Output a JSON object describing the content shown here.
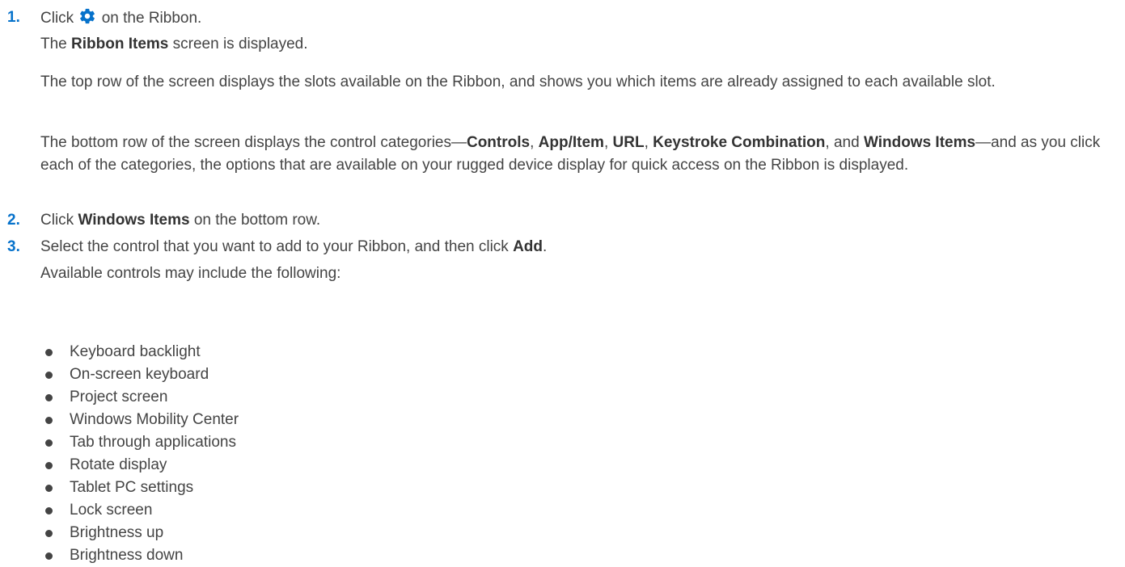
{
  "step1": {
    "number": "1.",
    "text_before_icon": "Click ",
    "icon": "gear-icon",
    "text_after_icon": " on the Ribbon.",
    "result_prefix": "The ",
    "result_bold": "Ribbon Items",
    "result_suffix": " screen is displayed.",
    "para1": "The top row of the screen displays the slots available on the Ribbon, and shows you which items are already assigned to each available slot.",
    "para2_a": "The bottom row of the screen displays the control categories—",
    "para2_controls": "Controls",
    "para2_sep1": ", ",
    "para2_app": "App/Item",
    "para2_sep2": ", ",
    "para2_url": "URL",
    "para2_sep3": ", ",
    "para2_keystroke": "Keystroke Combination",
    "para2_sep4": ", and ",
    "para2_windows": "Windows Items",
    "para2_b": "—and as you click each of the categories, the options that are available on your rugged device display for quick access on the Ribbon is displayed."
  },
  "step2": {
    "number": "2.",
    "prefix": "Click ",
    "bold": "Windows Items",
    "suffix": " on the bottom row."
  },
  "step3": {
    "number": "3.",
    "prefix": "Select the control that you want to add to your Ribbon, and then click ",
    "bold": "Add",
    "suffix": ".",
    "intro": "Available controls may include the following:",
    "items": [
      "Keyboard backlight",
      "On-screen keyboard",
      "Project screen",
      "Windows Mobility Center",
      "Tab through applications",
      "Rotate display",
      "Tablet PC settings",
      "Lock screen",
      "Brightness up",
      "Brightness down"
    ]
  },
  "colors": {
    "text": "#444444",
    "step_number": "#0672cb",
    "gear_icon": "#0672cb"
  }
}
